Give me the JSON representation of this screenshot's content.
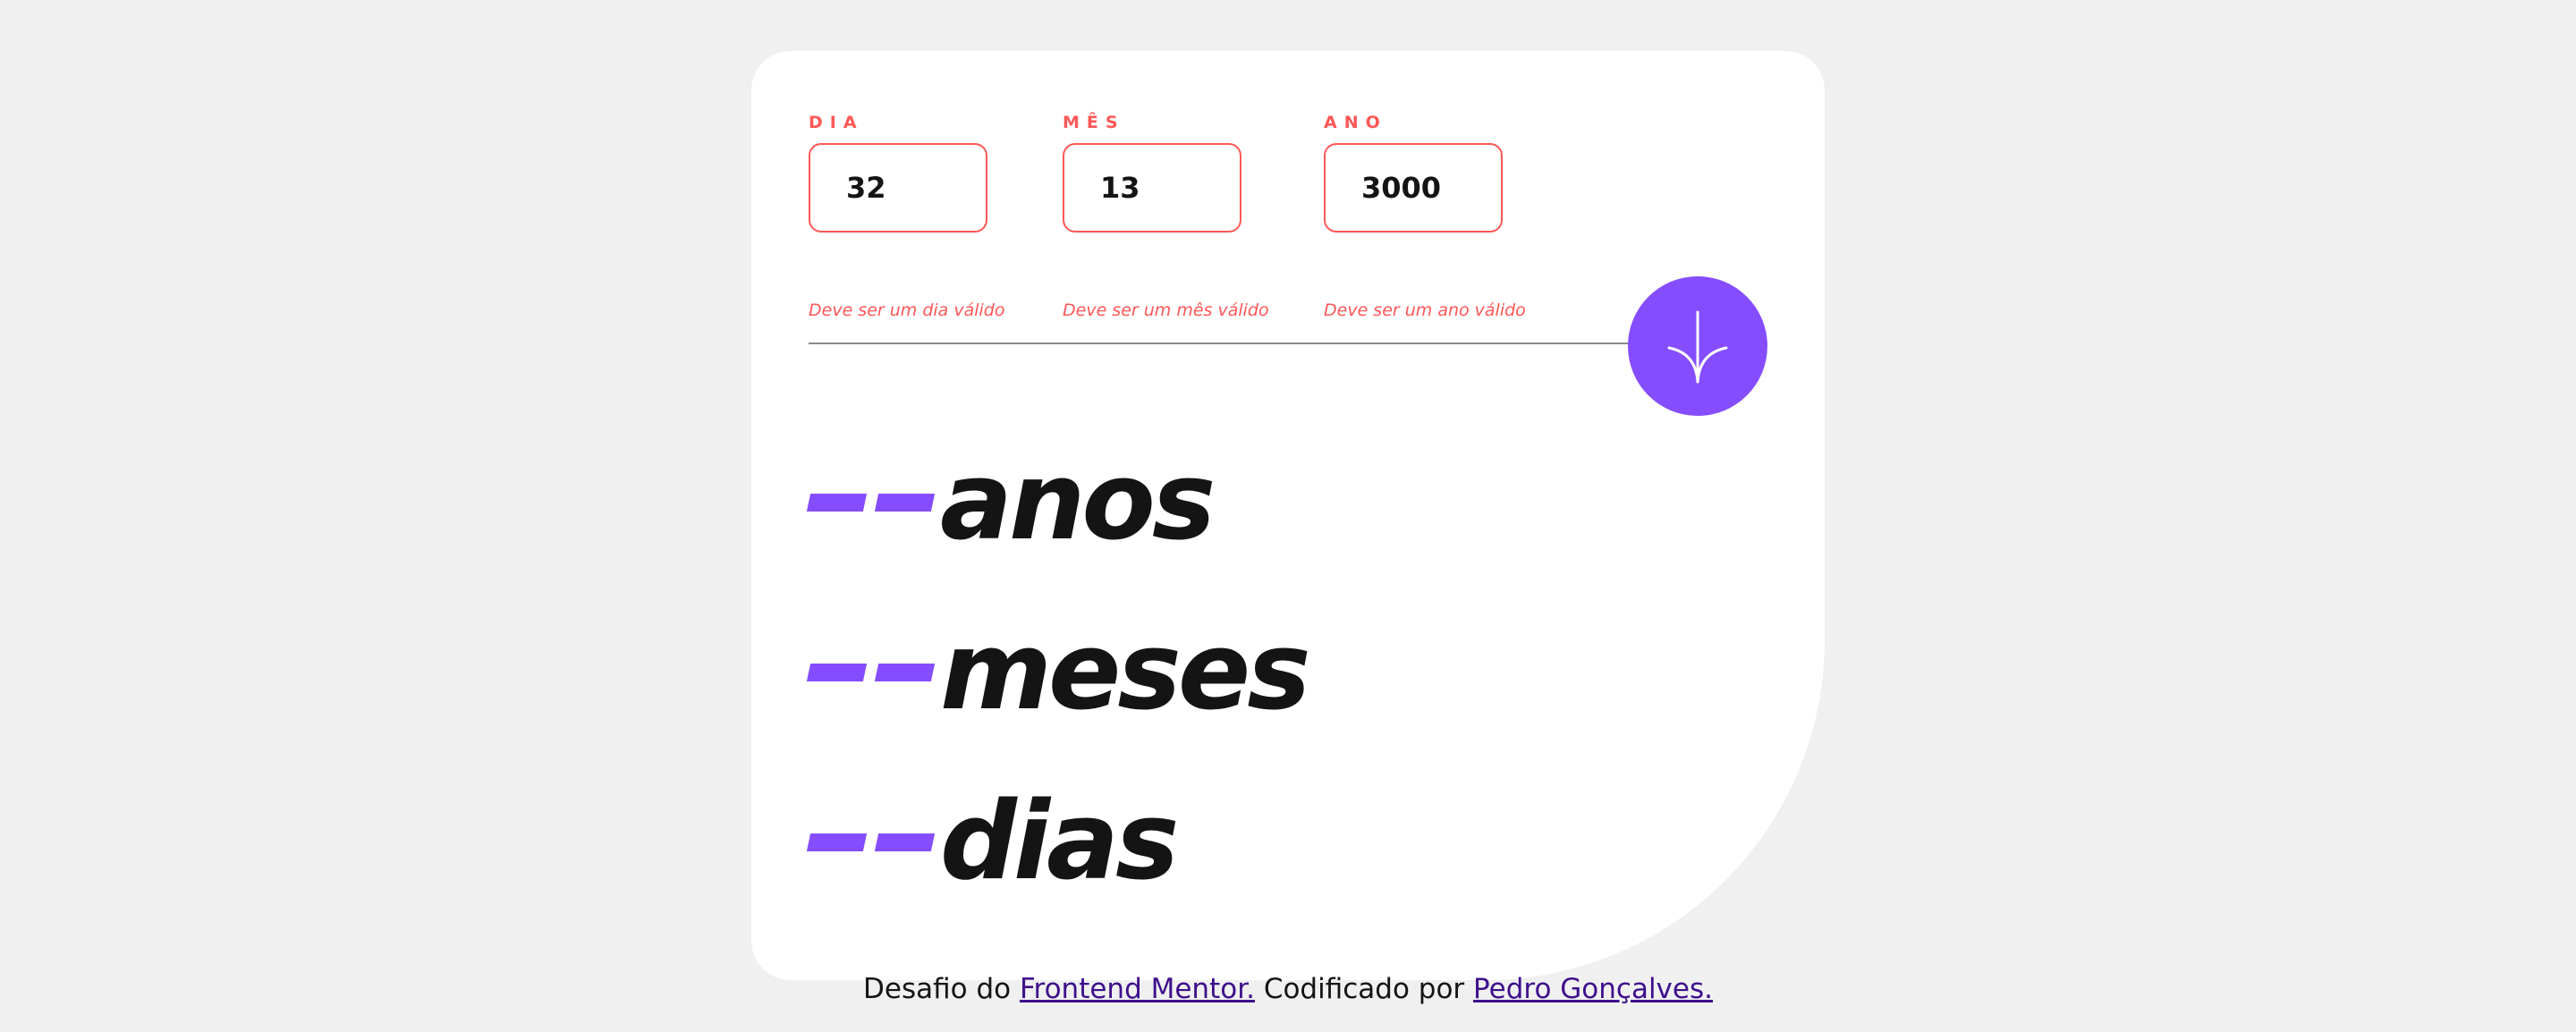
{
  "form": {
    "day": {
      "label": "DIA",
      "value": "32",
      "error": "Deve ser um dia válido"
    },
    "month": {
      "label": "MÊS",
      "value": "13",
      "error": "Deve ser um mês válido"
    },
    "year": {
      "label": "ANO",
      "value": "3000",
      "error": "Deve ser um ano válido"
    },
    "submit_icon": "arrow-down-icon"
  },
  "results": {
    "years": {
      "value": "--",
      "unit": "anos"
    },
    "months": {
      "value": "--",
      "unit": "meses"
    },
    "days": {
      "value": "--",
      "unit": "dias"
    }
  },
  "footer": {
    "prefix": "Desafio do ",
    "link1": "Frontend Mentor.",
    "middle": " Codificado por ",
    "link2": "Pedro Gonçalves."
  },
  "colors": {
    "accent": "#854dff",
    "error": "#ff5757",
    "background": "#f0f0f0",
    "card": "#ffffff",
    "text": "#141414",
    "link": "#3e0f8c"
  }
}
